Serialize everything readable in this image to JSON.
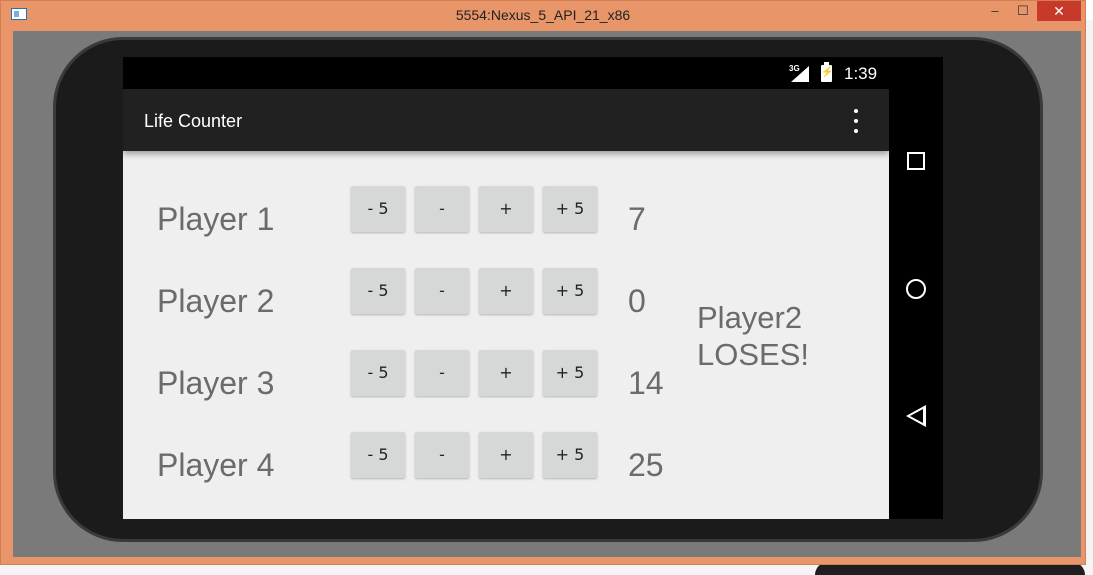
{
  "window": {
    "title": "5554:Nexus_5_API_21_x86",
    "controls": {
      "minimize": "–",
      "maximize": "☐",
      "close": "✕"
    }
  },
  "status_bar": {
    "network": "3G",
    "time": "1:39"
  },
  "app": {
    "title": "Life Counter"
  },
  "buttons": {
    "minus5": "- 5",
    "minus1": "-",
    "plus1": "+",
    "plus5": "+ 5"
  },
  "players": [
    {
      "name": "Player 1",
      "life": "7"
    },
    {
      "name": "Player 2",
      "life": "0"
    },
    {
      "name": "Player 3",
      "life": "14"
    },
    {
      "name": "Player 4",
      "life": "25"
    }
  ],
  "status_message": {
    "line1": "Player2",
    "line2": "LOSES!"
  },
  "icons": {
    "overflow": "overflow-menu-icon",
    "recent": "recent-apps-icon",
    "home": "home-icon",
    "back": "back-icon"
  },
  "colors": {
    "window_frame": "#e8956a",
    "action_bar": "#212121",
    "content_bg": "#efefef",
    "button_bg": "#d6d7d7",
    "text_gray": "#6b6b6b"
  }
}
